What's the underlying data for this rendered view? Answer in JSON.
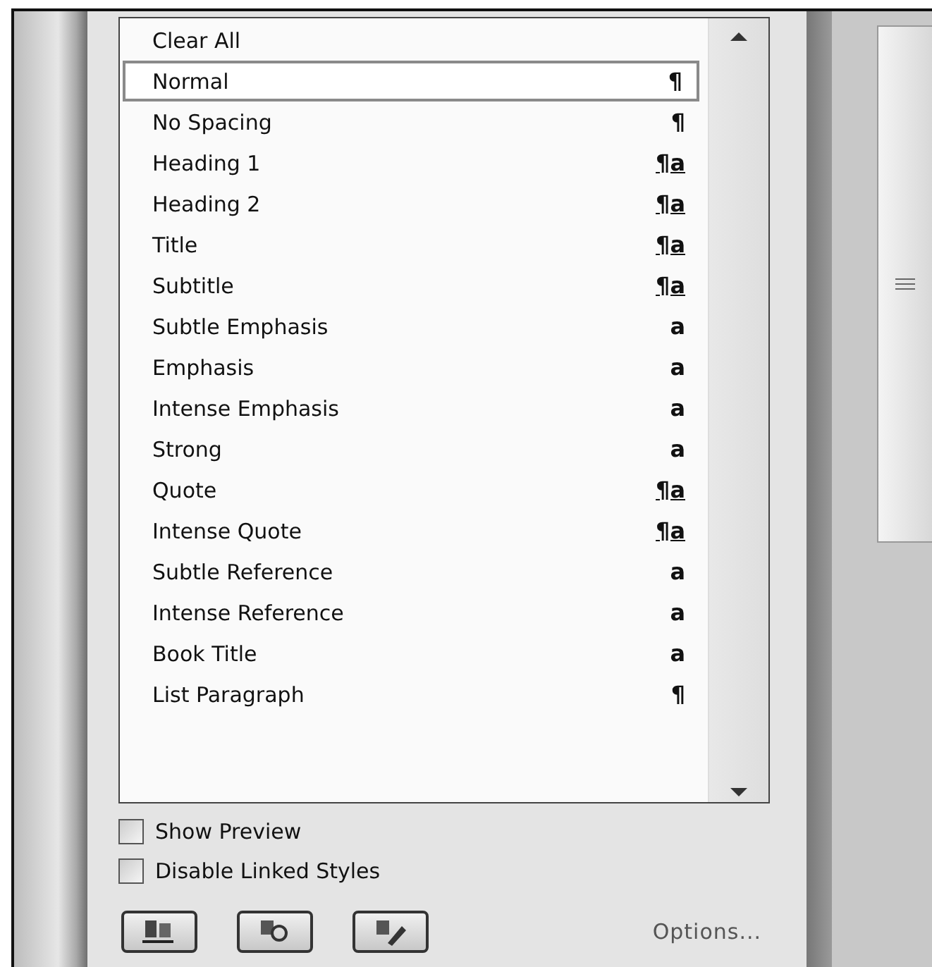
{
  "styles": [
    {
      "label": "Clear All",
      "selected": false
    },
    {
      "label": "Normal",
      "kind": "paragraph",
      "marker": "¶",
      "selected": true
    },
    {
      "label": "No Spacing",
      "kind": "paragraph",
      "marker": "¶",
      "selected": false
    },
    {
      "label": "Heading 1",
      "kind": "linked",
      "marker": "¶a",
      "selected": false
    },
    {
      "label": "Heading 2",
      "kind": "linked",
      "marker": "¶a",
      "selected": false
    },
    {
      "label": "Title",
      "kind": "linked",
      "marker": "¶a",
      "selected": false
    },
    {
      "label": "Subtitle",
      "kind": "linked",
      "marker": "¶a",
      "selected": false
    },
    {
      "label": "Subtle Emphasis",
      "kind": "character",
      "marker": "a",
      "selected": false
    },
    {
      "label": "Emphasis",
      "kind": "character",
      "marker": "a",
      "selected": false
    },
    {
      "label": "Intense Emphasis",
      "kind": "character",
      "marker": "a",
      "selected": false
    },
    {
      "label": "Strong",
      "kind": "character",
      "marker": "a",
      "selected": false
    },
    {
      "label": "Quote",
      "kind": "linked",
      "marker": "¶a",
      "selected": false
    },
    {
      "label": "Intense Quote",
      "kind": "linked",
      "marker": "¶a",
      "selected": false
    },
    {
      "label": "Subtle Reference",
      "kind": "character",
      "marker": "a",
      "selected": false
    },
    {
      "label": "Intense Reference",
      "kind": "character",
      "marker": "a",
      "selected": false
    },
    {
      "label": "Book Title",
      "kind": "character",
      "marker": "a",
      "selected": false
    },
    {
      "label": "List Paragraph",
      "kind": "paragraph",
      "marker": "¶",
      "selected": false
    }
  ],
  "options": [
    {
      "label": "Show Preview",
      "checked": false
    },
    {
      "label": "Disable Linked Styles",
      "checked": false
    }
  ],
  "toolbar": {
    "buttons": [
      {
        "kind": "new"
      },
      {
        "kind": "inspect"
      },
      {
        "kind": "manage"
      }
    ],
    "options_link": "Options..."
  }
}
